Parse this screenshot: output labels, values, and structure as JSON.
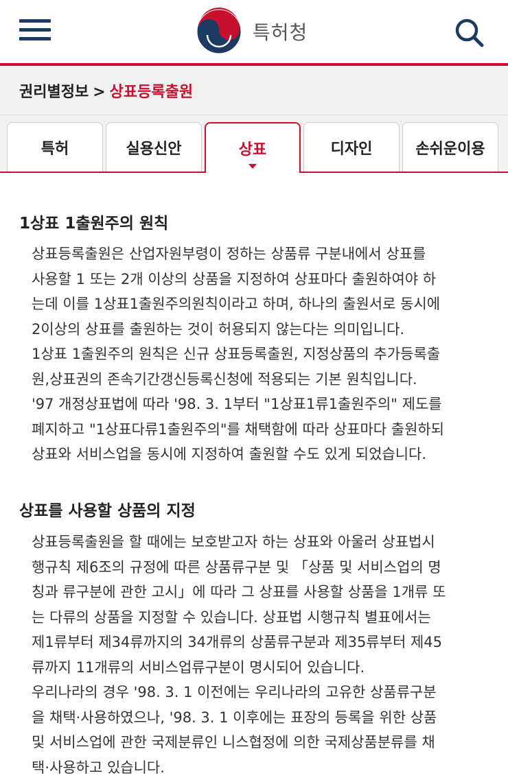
{
  "header": {
    "logo_text": "특허청",
    "menu_icon": "hamburger-menu-icon",
    "search_icon": "search-icon",
    "logo_icon": "taegeuk-logo-icon",
    "accent": "#c8102e",
    "navy": "#1d3a63"
  },
  "breadcrumb": {
    "parent": "권리별정보",
    "separator": ">",
    "current": "상표등록출원"
  },
  "tabs": [
    {
      "label": "특허",
      "active": false
    },
    {
      "label": "실용신안",
      "active": false
    },
    {
      "label": "상표",
      "active": true
    },
    {
      "label": "디자인",
      "active": false
    },
    {
      "label": "손쉬운이용",
      "active": false
    }
  ],
  "sections": [
    {
      "title": "1상표 1출원주의 원칙",
      "lines": [
        "상표등록출원은 산업자원부령이 정하는 상품류 구분내에서 상표를",
        "사용할 1 또는 2개 이상의 상품을 지정하여 상표마다 출원하여야 하",
        "는데 이를 1상표1출원주의원칙이라고 하며, 하나의 출원서로 동시에",
        "2이상의 상표를 출원하는 것이 허용되지 않는다는 의미입니다.",
        "1상표 1출원주의 원칙은 신규 상표등록출원, 지정상품의 추가등록출",
        "원,상표권의 존속기간갱신등록신청에 적용되는 기본 원칙입니다.",
        "'97 개정상표법에 따라 '98. 3. 1부터 \"1상표1류1출원주의\" 제도를",
        "폐지하고 \"1상표다류1출원주의\"를 채택함에 따라 상표마다 출원하되",
        "상표와 서비스업을 동시에 지정하여 출원할 수도 있게 되었습니다."
      ]
    },
    {
      "title": "상표를 사용할 상품의 지정",
      "lines": [
        "상표등록출원을 할 때에는 보호받고자 하는 상표와 아울러 상표법시",
        "행규칙 제6조의 규정에 따른 상품류구분 및 「상품 및 서비스업의 명",
        "칭과 류구분에 관한 고시」에 따라 그 상표를 사용할 상품을 1개류 또",
        "는 다류의 상품을 지정할 수 있습니다. 상표법 시행규칙 별표에서는",
        "제1류부터 제34류까지의 34개류의 상품류구분과 제35류부터 제45",
        "류까지 11개류의 서비스업류구분이 명시되어 있습니다.",
        "우리나라의 경우 '98. 3. 1 이전에는 우리나라의 고유한 상품류구분",
        "을 채택·사용하였으나, '98. 3. 1 이후에는 표장의 등록을 위한 상품",
        "및 서비스업에 관한 국제분류인 니스협정에 의한 국제상품분류를 채",
        "택·사용하고 있습니다."
      ]
    }
  ]
}
